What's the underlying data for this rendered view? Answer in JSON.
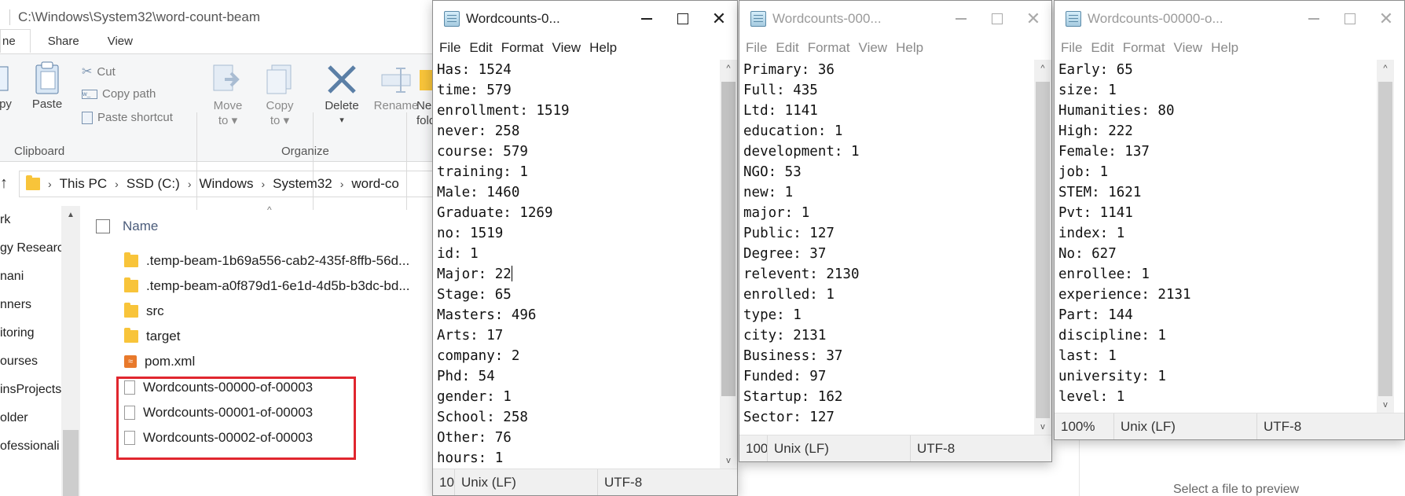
{
  "explorer": {
    "title": "C:\\Windows\\System32\\word-count-beam",
    "tabs": [
      "ne",
      "Share",
      "View"
    ],
    "ribbon": {
      "copy_label": "py",
      "paste_label": "Paste",
      "cut_label": "Cut",
      "copy_path_label": "Copy path",
      "paste_shortcut_label": "Paste shortcut",
      "move_to_label": "Move to ▾",
      "copy_to_label": "Copy to ▾",
      "delete_label": "Delete",
      "delete_arrow": "▾",
      "rename_label": "Rename",
      "new_folder_label": "Ne fold",
      "group_clipboard": "Clipboard",
      "group_organize": "Organize"
    },
    "address": {
      "back_arrow": "↑",
      "crumbs": [
        "This PC",
        "SSD (C:)",
        "Windows",
        "System32",
        "word-co"
      ]
    },
    "nav_items": [
      "rk",
      "gy Researc",
      "nani",
      "nners",
      "itoring",
      "ourses",
      "insProjects",
      "older",
      "ofessionali"
    ],
    "column_header": "Name",
    "files": [
      {
        "name": ".temp-beam-1b69a556-cab2-435f-8ffb-56d...",
        "kind": "folder"
      },
      {
        "name": ".temp-beam-a0f879d1-6e1d-4d5b-b3dc-bd...",
        "kind": "folder"
      },
      {
        "name": "src",
        "kind": "folder"
      },
      {
        "name": "target",
        "kind": "folder"
      },
      {
        "name": "pom.xml",
        "kind": "xml"
      },
      {
        "name": "Wordcounts-00000-of-00003",
        "kind": "file"
      },
      {
        "name": "Wordcounts-00001-of-00003",
        "kind": "file"
      },
      {
        "name": "Wordcounts-00002-of-00003",
        "kind": "file"
      }
    ],
    "preview_text": "Select a file to preview",
    "highlight_color": "#e0262e"
  },
  "notepads": [
    {
      "title": "Wordcounts-0...",
      "active": true,
      "menu": [
        "File",
        "Edit",
        "Format",
        "View",
        "Help"
      ],
      "lines": [
        "Has: 1524",
        "time: 579",
        "enrollment: 1519",
        "never: 258",
        "course: 579",
        "training: 1",
        "Male: 1460",
        "Graduate: 1269",
        "no: 1519",
        "id: 1",
        "Major: 22",
        "Stage: 65",
        "Masters: 496",
        "Arts: 17",
        "company: 2",
        "Phd: 54",
        "gender: 1",
        "School: 258",
        "Other: 76",
        "hours: 1"
      ],
      "status": {
        "zoom": "10",
        "eol": "Unix (LF)",
        "encoding": "UTF-8"
      }
    },
    {
      "title": "Wordcounts-000...",
      "active": false,
      "menu": [
        "File",
        "Edit",
        "Format",
        "View",
        "Help"
      ],
      "lines": [
        "Primary: 36",
        "Full: 435",
        "Ltd: 1141",
        "education: 1",
        "development: 1",
        "NGO: 53",
        "new: 1",
        "major: 1",
        "Public: 127",
        "Degree: 37",
        "relevent: 2130",
        "enrolled: 1",
        "type: 1",
        "city: 2131",
        "Business: 37",
        "Funded: 97",
        "Startup: 162",
        "Sector: 127"
      ],
      "status": {
        "zoom": "100",
        "eol": "Unix (LF)",
        "encoding": "UTF-8"
      }
    },
    {
      "title": "Wordcounts-00000-o...",
      "active": false,
      "menu": [
        "File",
        "Edit",
        "Format",
        "View",
        "Help"
      ],
      "lines": [
        "Early: 65",
        "size: 1",
        "Humanities: 80",
        "High: 222",
        "Female: 137",
        "job: 1",
        "STEM: 1621",
        "Pvt: 1141",
        "index: 1",
        "No: 627",
        "enrollee: 1",
        "experience: 2131",
        "Part: 144",
        "discipline: 1",
        "last: 1",
        "university: 1",
        "level: 1"
      ],
      "status": {
        "zoom": "100%",
        "eol": "Unix (LF)",
        "encoding": "UTF-8"
      }
    }
  ]
}
